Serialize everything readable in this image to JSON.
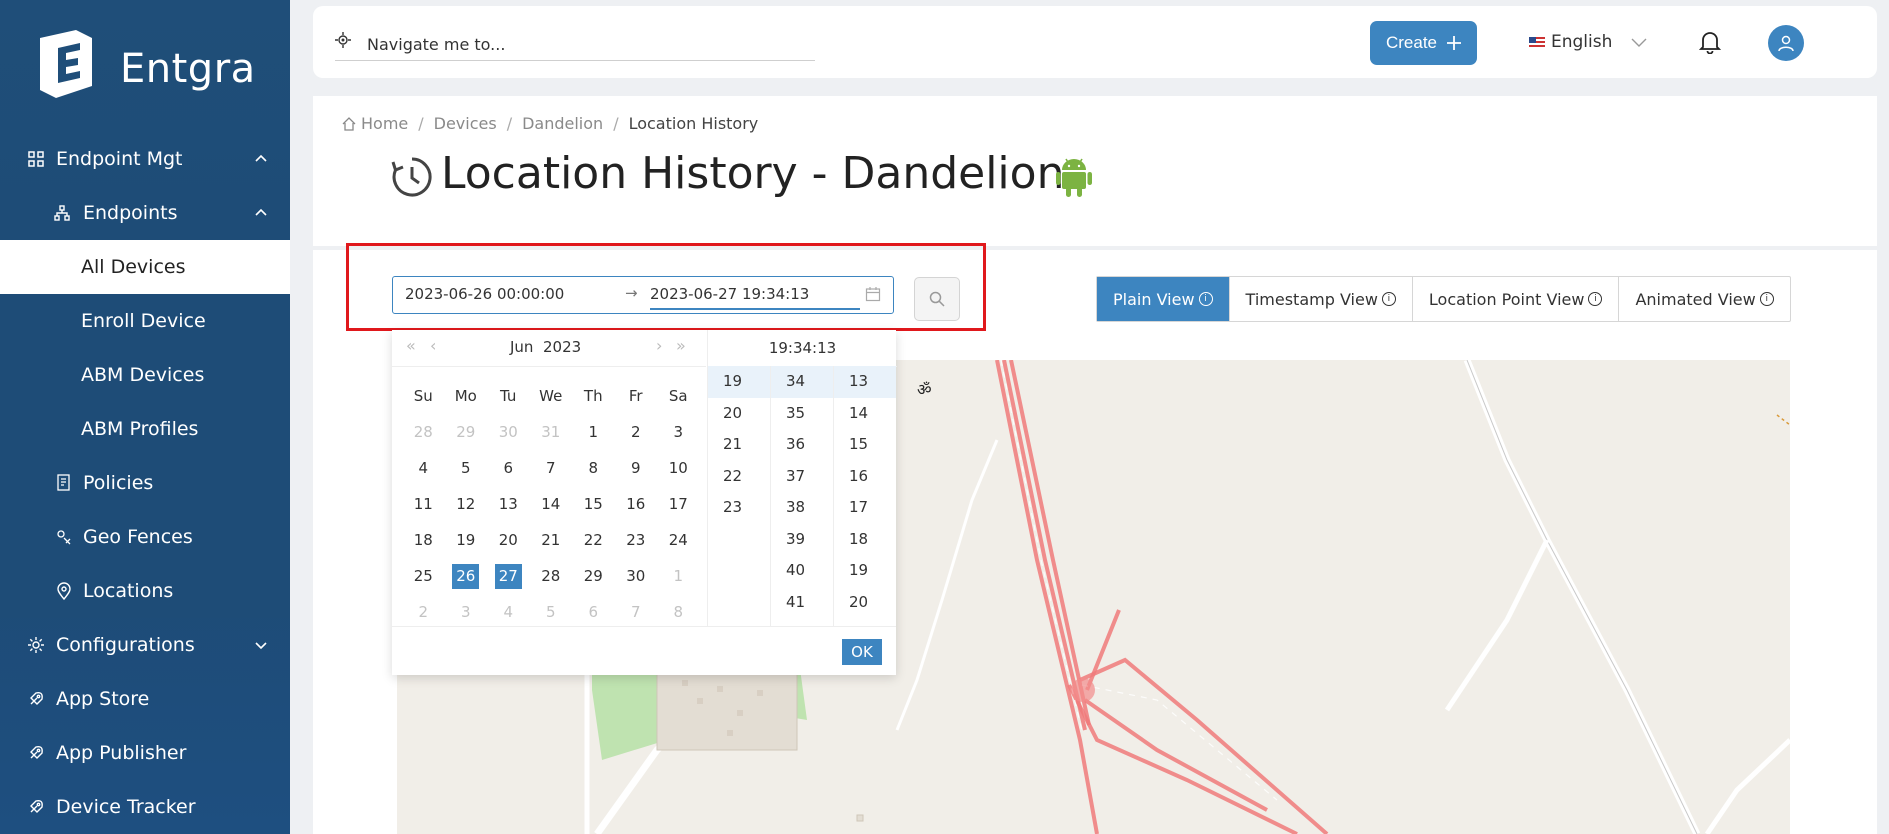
{
  "brand": {
    "name": "Entgra"
  },
  "sidebar": {
    "items": [
      {
        "label": "Endpoint Mgt",
        "icon": "grid-icon"
      },
      {
        "label": "Endpoints",
        "icon": "sitemap-icon"
      },
      {
        "label": "All Devices"
      },
      {
        "label": "Enroll Device"
      },
      {
        "label": "ABM Devices"
      },
      {
        "label": "ABM Profiles"
      },
      {
        "label": "Policies",
        "icon": "policy-icon"
      },
      {
        "label": "Geo Fences",
        "icon": "geofence-icon"
      },
      {
        "label": "Locations",
        "icon": "location-pin-icon"
      },
      {
        "label": "Configurations",
        "icon": "gear-icon"
      },
      {
        "label": "App Store",
        "icon": "rocket-icon"
      },
      {
        "label": "App Publisher",
        "icon": "rocket-icon"
      },
      {
        "label": "Device Tracker",
        "icon": "rocket-icon"
      }
    ]
  },
  "topbar": {
    "search_placeholder": "Navigate me to...",
    "create_label": "Create",
    "language": "English"
  },
  "breadcrumb": [
    "Home",
    "Devices",
    "Dandelion",
    "Location History"
  ],
  "page": {
    "title": "Location History - Dandelion"
  },
  "range": {
    "start": "2023-06-26 00:00:00",
    "arrow": "→",
    "end": "2023-06-27 19:34:13"
  },
  "view_tabs": [
    "Plain View",
    "Timestamp View",
    "Location Point View",
    "Animated View"
  ],
  "picker": {
    "month": "Jun",
    "year": "2023",
    "time": "19:34:13",
    "weekdays": [
      "Su",
      "Mo",
      "Tu",
      "We",
      "Th",
      "Fr",
      "Sa"
    ],
    "weeks": [
      [
        "28",
        "29",
        "30",
        "31",
        "1",
        "2",
        "3"
      ],
      [
        "4",
        "5",
        "6",
        "7",
        "8",
        "9",
        "10"
      ],
      [
        "11",
        "12",
        "13",
        "14",
        "15",
        "16",
        "17"
      ],
      [
        "18",
        "19",
        "20",
        "21",
        "22",
        "23",
        "24"
      ],
      [
        "25",
        "26",
        "27",
        "28",
        "29",
        "30",
        "1"
      ],
      [
        "2",
        "3",
        "4",
        "5",
        "6",
        "7",
        "8"
      ]
    ],
    "hours": [
      "19",
      "20",
      "21",
      "22",
      "23"
    ],
    "minutes": [
      "34",
      "35",
      "36",
      "37",
      "38",
      "39",
      "40",
      "41"
    ],
    "seconds": [
      "13",
      "14",
      "15",
      "16",
      "17",
      "18",
      "19",
      "20"
    ],
    "ok_label": "OK"
  },
  "map": {
    "om_symbol": "ॐ"
  },
  "colors": {
    "sidebar": "#1f4e79",
    "accent": "#3d85c0",
    "highlight": "#e0181c",
    "route": "#f07a7a"
  }
}
